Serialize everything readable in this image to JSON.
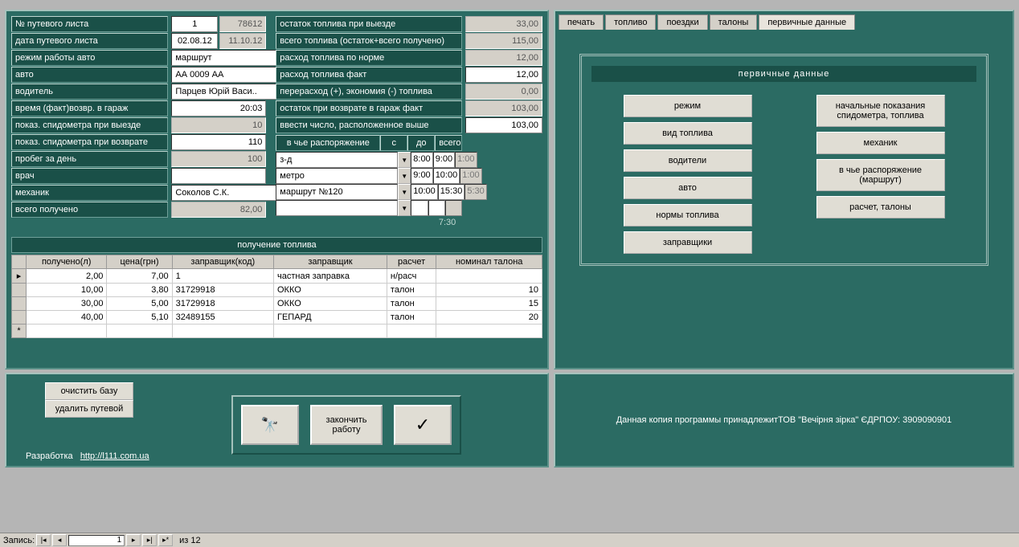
{
  "left_labels": {
    "sheet_no": "№ путевого листа",
    "sheet_date": "дата путевого листа",
    "work_mode": "режим работы авто",
    "auto": "авто",
    "driver": "водитель",
    "return_time": "время (факт)возвр. в гараж",
    "odo_out": "показ. спидометра при выезде",
    "odo_in": "показ. спидометра при возврате",
    "day_run": "пробег за день",
    "doctor": "врач",
    "mechanic": "механик",
    "total_received": "всего получено"
  },
  "left_values": {
    "sheet_no": "1",
    "sheet_no_grey": "78612",
    "sheet_date": "02.08.12",
    "sheet_date_grey": "11.10.12",
    "work_mode": "маршрут",
    "auto": "АА 0009 АА",
    "driver": "Парцев Юрій Васи..",
    "return_time": "20:03",
    "odo_out": "10",
    "odo_in": "110",
    "day_run": "100",
    "doctor": "",
    "mechanic": "Соколов С.К.",
    "total_received": "82,00"
  },
  "mid_labels": {
    "fuel_out": "остаток топлива при выезде",
    "fuel_total": "всего топлива (остаток+всего получено)",
    "fuel_norm": "расход топлива по норме",
    "fuel_fact": "расход топлива факт",
    "fuel_diff": "перерасход (+), экономия (-) топлива",
    "fuel_return": "остаток при возврате в гараж  факт",
    "enter_above": "ввести число, расположенное выше"
  },
  "mid_values": {
    "fuel_out": "33,00",
    "fuel_total": "115,00",
    "fuel_norm": "12,00",
    "fuel_fact": "12,00",
    "fuel_diff": "0,00",
    "fuel_return": "103,00",
    "enter_above": "103,00"
  },
  "disposition": {
    "title": "в чье распоряжение",
    "col_from": "с",
    "col_to": "до",
    "col_total": "всего",
    "rows": [
      {
        "name": "з-д\"Оболонь\"-вул.Теліги",
        "from": "8:00",
        "to": "9:00",
        "total": "1:00"
      },
      {
        "name": "метро\"Нивки\"-Завод\"Авіант\"",
        "from": "9:00",
        "to": "10:00",
        "total": "1:00"
      },
      {
        "name": "маршрут №120",
        "from": "10:00",
        "to": "15:30",
        "total": "5:30"
      },
      {
        "name": "",
        "from": "",
        "to": "",
        "total": ""
      }
    ],
    "footer_total": "7:30"
  },
  "fuel_section": {
    "title": "получение топлива",
    "cols": {
      "received": "получено(л)",
      "price": "цена(грн)",
      "station_code": "заправщик(код)",
      "station": "заправщик",
      "calc": "расчет",
      "nominal": "номинал талона"
    },
    "rows": [
      {
        "received": "2,00",
        "price": "7,00",
        "code": "1",
        "station": "частная заправка",
        "calc": "н/расч",
        "nominal": ""
      },
      {
        "received": "10,00",
        "price": "3,80",
        "code": "31729918",
        "station": "ОККО",
        "calc": "талон",
        "nominal": "10"
      },
      {
        "received": "30,00",
        "price": "5,00",
        "code": "31729918",
        "station": "ОККО",
        "calc": "талон",
        "nominal": "15"
      },
      {
        "received": "40,00",
        "price": "5,10",
        "code": "32489155",
        "station": "ГЕПАРД",
        "calc": "талон",
        "nominal": "20"
      }
    ]
  },
  "tabs": {
    "print": "печать",
    "fuel": "топливо",
    "trips": "поездки",
    "coupons": "талоны",
    "primary": "первичные данные"
  },
  "right_panel": {
    "title": "первичные данные",
    "btns_left": [
      "режим",
      "вид топлива",
      "водители",
      "авто",
      "нормы топлива",
      "заправщики"
    ],
    "btns_right": [
      "начальные показания спидометра, топлива",
      "механик",
      "в чье распоряжение (маршрут)",
      "расчет, талоны"
    ]
  },
  "bottom": {
    "clear_db": "очистить базу",
    "delete_sheet": "удалить путевой",
    "finish": "закончить\nработу",
    "dev": "Разработка",
    "dev_url": "http://l111.com.ua",
    "copy_text": "Данная копия программы принадлежитТОВ \"Вечірня зірка\"    ЄДРПОУ: 3909090901"
  },
  "nav": {
    "label": "Запись:",
    "current": "1",
    "of": "из  12"
  }
}
